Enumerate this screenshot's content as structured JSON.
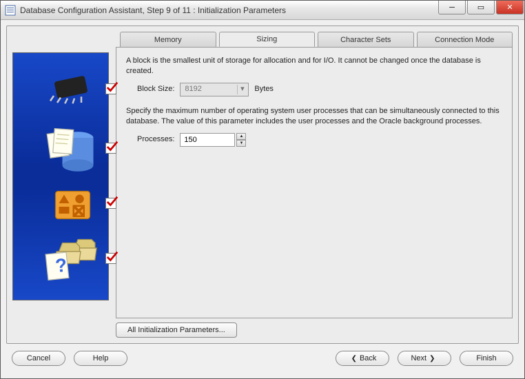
{
  "window": {
    "title": "Database Configuration Assistant, Step 9 of 11 : Initialization Parameters"
  },
  "tabs": {
    "memory": "Memory",
    "sizing": "Sizing",
    "charset": "Character Sets",
    "connmode": "Connection Mode",
    "active": "sizing"
  },
  "sizing": {
    "block_desc": "A block is the smallest unit of storage for allocation and for I/O. It cannot be changed once the database is created.",
    "block_label": "Block Size:",
    "block_value": "8192",
    "block_unit": "Bytes",
    "proc_desc": "Specify the maximum number of operating system user processes that can be simultaneously connected to this database. The value of this parameter includes the user processes and the Oracle background processes.",
    "proc_label": "Processes:",
    "proc_value": "150"
  },
  "buttons": {
    "all_params": "All Initialization Parameters...",
    "cancel": "Cancel",
    "help": "Help",
    "back": "Back",
    "next": "Next",
    "finish": "Finish"
  },
  "sidebar_icons": {
    "chip": "chip-icon",
    "files": "files-icon",
    "shapes": "shapes-icon",
    "help": "help-folder-icon"
  }
}
